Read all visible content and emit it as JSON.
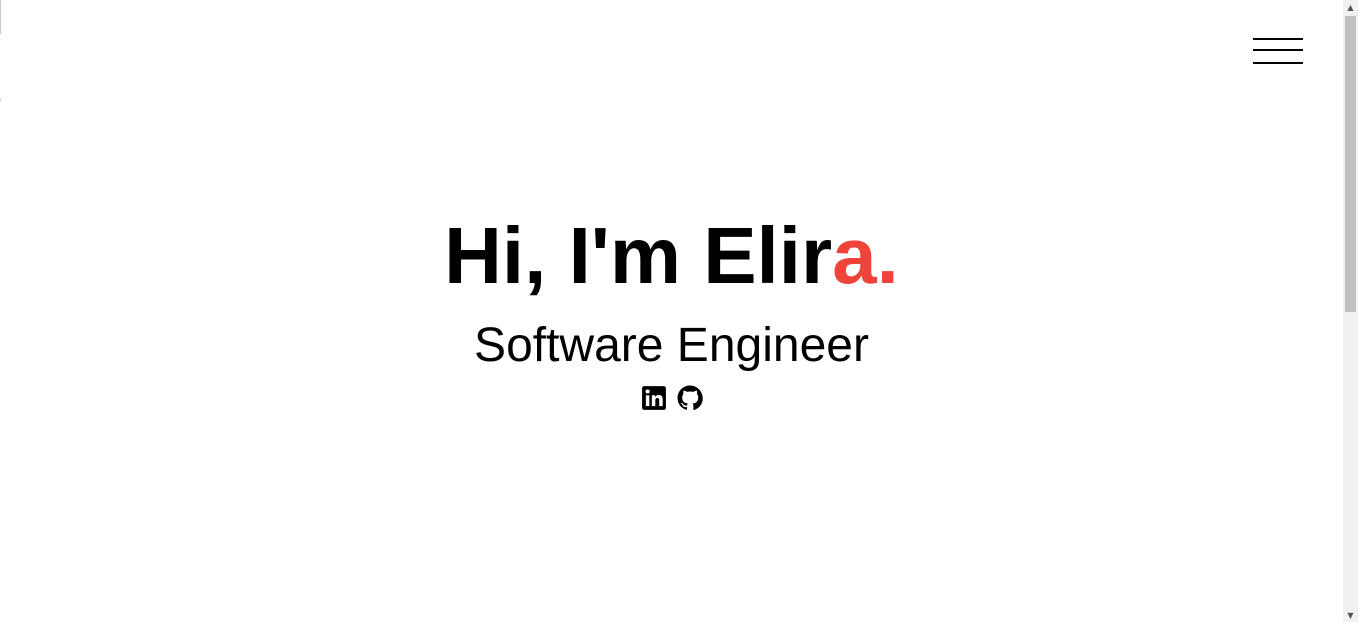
{
  "hero": {
    "title_main": "Hi, I'm Elir",
    "title_accent": "a.",
    "subtitle": "Software Engineer"
  },
  "social": {
    "items": [
      {
        "icon": "linkedin-icon"
      },
      {
        "icon": "github-icon"
      }
    ]
  },
  "menu": {
    "icon": "hamburger-menu-icon"
  },
  "scrollbar": {
    "up_glyph": "▲",
    "down_glyph": "▼"
  },
  "colors": {
    "accent": "#f0443a",
    "text": "#000000",
    "background": "#ffffff"
  }
}
